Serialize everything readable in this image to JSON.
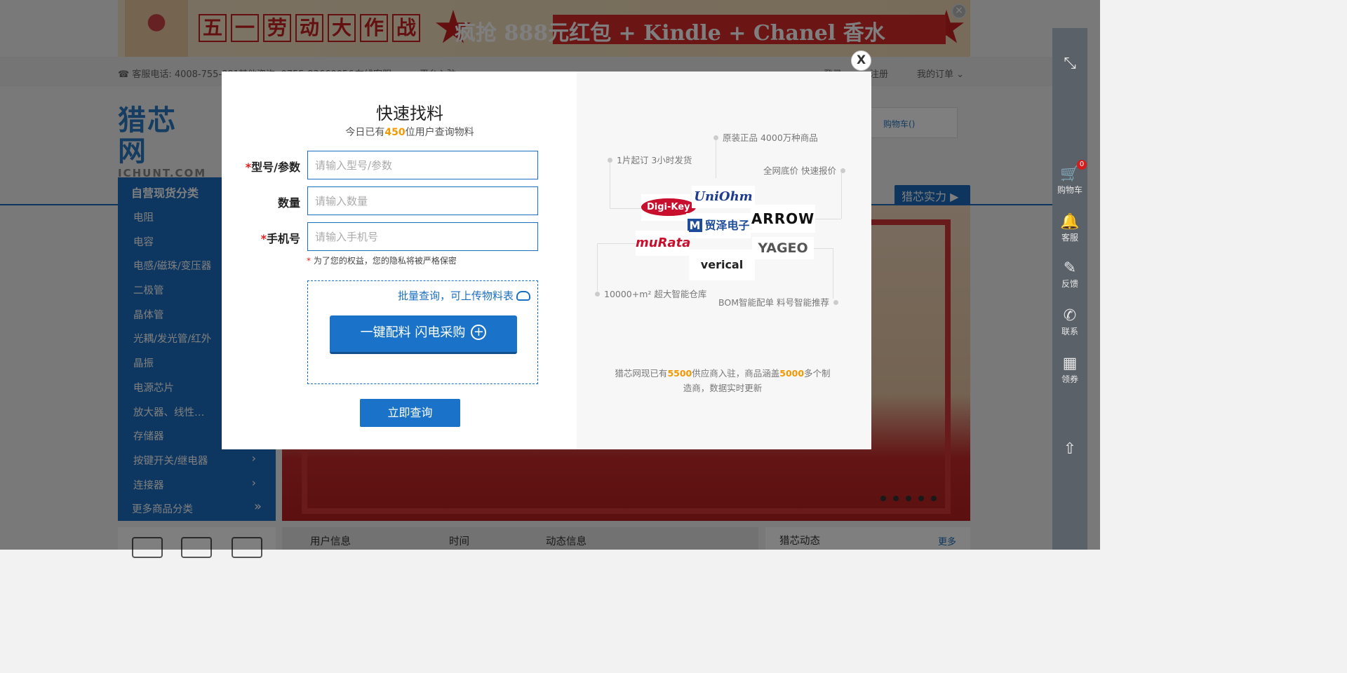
{
  "banner": {
    "boxes": [
      "五",
      "一",
      "劳",
      "动",
      "大",
      "作",
      "战"
    ],
    "promo": "疯抢 888元红包 + Kindle + Chanel 香水",
    "close": "×"
  },
  "topbar": {
    "service_phone": "客服电话: 4008-755-881",
    "other_consult": "其他咨询: 0755-83660056",
    "online_service": "在线客服",
    "platform_entry": "平台入驻",
    "login": "登录",
    "register": "注册",
    "my_orders": "我的订单"
  },
  "header": {
    "logo_cn": "猎芯网",
    "logo_en": "ICHUNT.COM",
    "cart": "购物车()",
    "strength": "猎芯实力"
  },
  "categories": {
    "title": "自营现货分类",
    "items": [
      {
        "label": "电阻",
        "chev": ""
      },
      {
        "label": "电容",
        "chev": ""
      },
      {
        "label": "电感/磁珠/变压器",
        "chev": ""
      },
      {
        "label": "二极管",
        "chev": ""
      },
      {
        "label": "晶体管",
        "chev": ""
      },
      {
        "label": "光耦/发光管/红外",
        "chev": ""
      },
      {
        "label": "晶振",
        "chev": ""
      },
      {
        "label": "电源芯片",
        "chev": ""
      },
      {
        "label": "放大器、线性…",
        "chev": ""
      },
      {
        "label": "存储器",
        "chev": ""
      },
      {
        "label": "按键开关/继电器",
        "chev": "›"
      },
      {
        "label": "连接器",
        "chev": "›"
      }
    ],
    "more": "更多商品分类",
    "more_chev": "»"
  },
  "dynamic_table": {
    "col_user": "用户信息",
    "col_time": "时间",
    "col_info": "动态信息"
  },
  "news": {
    "title": "猎芯动态",
    "more": "更多"
  },
  "right_sidebar": {
    "collapse_icon": "⤡",
    "cart_label": "购物车",
    "cart_count": "0",
    "service_label": "客服",
    "feedback_label": "反馈",
    "contact_label": "联系",
    "coupon_label": "领券",
    "top_icon": "⇧"
  },
  "modal": {
    "close": "X",
    "title": "快速找料",
    "sub_prefix": "今日已有",
    "sub_num": "450",
    "sub_suffix": "位用户查询物料",
    "fields": {
      "model": {
        "req": "*",
        "label": "型号/参数",
        "placeholder": "请输入型号/参数"
      },
      "qty": {
        "req": "",
        "label": "数量",
        "placeholder": "请输入数量"
      },
      "phone": {
        "req": "*",
        "label": "手机号",
        "placeholder": "请输入手机号"
      }
    },
    "privacy_req": "*",
    "privacy": " 为了您的权益，您的隐私将被严格保密",
    "upload_link": "批量查询，可上传物料表",
    "bom_button": "一键配料 闪电采购",
    "bom_plus": "+",
    "query_button": "立即查询",
    "features": {
      "f1": "1片起订 3小时发货",
      "f2": "原装正品 4000万种商品",
      "f3": "全网底价 快速报价",
      "f4": "10000+m² 超大智能仓库",
      "f5": "BOM智能配单 料号智能推荐"
    },
    "brands": {
      "digikey": "Digi-Key",
      "uniohm": "UniOhm",
      "mouser": "贸泽电子",
      "arrow": "ARROW",
      "murata": "muRata",
      "verical": "verical",
      "yageo": "YAGEO"
    },
    "note_p1": "猎芯网现已有",
    "note_n1": "5500",
    "note_p2": "供应商入驻，商品涵盖",
    "note_n2": "5000",
    "note_p3": "多个制造商，数据实时更新"
  },
  "colors": {
    "primary": "#1b6fc0",
    "accent_orange": "#f39800",
    "banner_red": "#c92121"
  }
}
